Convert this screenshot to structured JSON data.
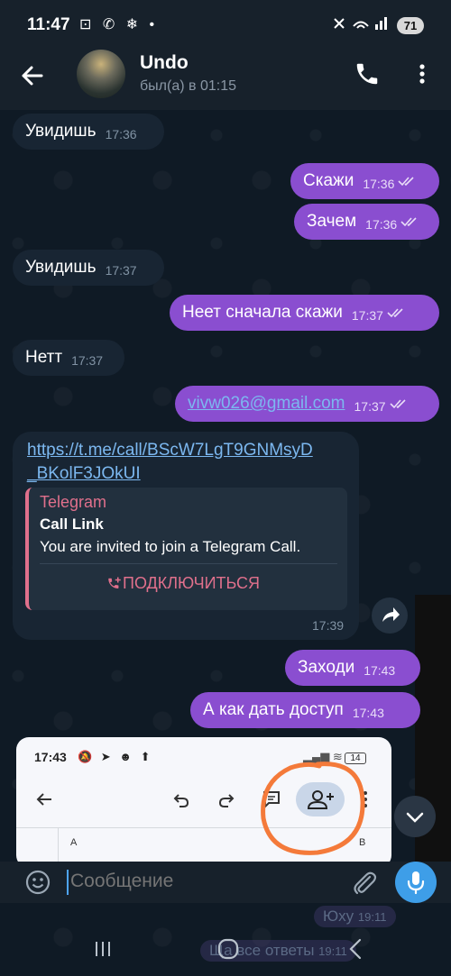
{
  "status_bar": {
    "time": "11:47",
    "left_icons": "⊡ ✆ ❄ •",
    "battery": "71"
  },
  "header": {
    "name": "Undo",
    "status": "был(а) в 01:15"
  },
  "messages": [
    {
      "dir": "in",
      "text": "Увидишь",
      "time": "17:36"
    },
    {
      "dir": "out",
      "text": "Скажи",
      "time": "17:36"
    },
    {
      "dir": "out",
      "text": "Зачем",
      "time": "17:36"
    },
    {
      "dir": "in",
      "text": "Увидишь",
      "time": "17:37"
    },
    {
      "dir": "out",
      "text": "Неет сначала скажи",
      "time": "17:37"
    },
    {
      "dir": "in",
      "text": "Нетт",
      "time": "17:37"
    },
    {
      "dir": "out",
      "text": "vivw026@gmail.com",
      "time": "17:37"
    },
    {
      "dir": "out",
      "text": "Заходи",
      "time": "17:43"
    },
    {
      "dir": "out",
      "text": "А как дать доступ",
      "time": "17:43"
    }
  ],
  "link_message": {
    "url_line1": "https://t.me/call/BScW7LgT9GNMsyD",
    "url_line2": "_BKolF3JOkUI",
    "preview_site": "Telegram",
    "preview_title": "Call Link",
    "preview_description": "You are invited to join a Telegram Call.",
    "join_label": "ПОДКЛЮЧИТЬСЯ",
    "time": "17:39"
  },
  "screenshot_preview": {
    "time": "17:43",
    "icons": "🔕 ➤ ☻ ⬆",
    "battery": "14",
    "col_a": "A",
    "col_b": "B"
  },
  "ghost_messages": {
    "text1": "Юху",
    "time1": "19:11",
    "text2": "Ща все ответы",
    "time2": "19:11"
  },
  "input": {
    "placeholder": "Сообщение"
  },
  "colors": {
    "background": "#0f1a25",
    "incoming_bubble": "#182533",
    "outgoing_bubble": "#8a4ed0",
    "accent_blue": "#3e9ee8",
    "preview_accent": "#e0708c",
    "annotation": "#f47a3a"
  }
}
